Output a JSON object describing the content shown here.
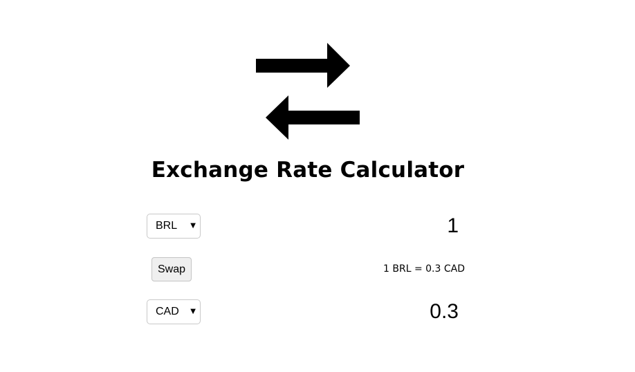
{
  "app": {
    "title": "Exchange Rate Calculator",
    "logo_icon": "swap-arrows-icon"
  },
  "converter": {
    "from_currency": "BRL",
    "from_amount": "1",
    "to_currency": "CAD",
    "to_amount": "0.3",
    "swap_label": "Swap",
    "rate_text": "1 BRL = 0.3 CAD",
    "caret_glyph": "▼"
  },
  "colors": {
    "background": "#ffffff",
    "text": "#000000",
    "button_bg": "#efefef",
    "border": "#c8c8c8"
  }
}
